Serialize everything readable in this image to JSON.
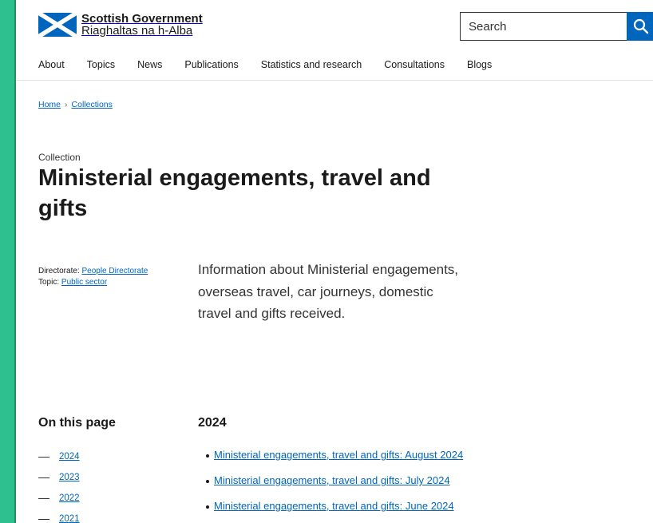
{
  "header": {
    "logo_en": "Scottish Government",
    "logo_gd": "Riaghaltas na h-Alba",
    "search_placeholder": "Search",
    "search_button_icon": "search-icon",
    "colors": {
      "accent": "#0065bd",
      "saltire_blue": "#0065bd",
      "saltire_white": "#ffffff",
      "backdrop": "#2fc08f"
    }
  },
  "nav": {
    "items": [
      "About",
      "Topics",
      "News",
      "Publications",
      "Statistics and research",
      "Consultations",
      "Blogs"
    ]
  },
  "breadcrumb": {
    "home": "Home",
    "separator": "›",
    "collections": "Collections"
  },
  "page": {
    "doc_type": "Collection",
    "title": "Ministerial engagements, travel and gifts",
    "directorate_label": "Directorate:",
    "directorate_value": "People Directorate",
    "topic_label": "Topic:",
    "topic_value": "Public sector",
    "summary": "Information about Ministerial engagements, overseas travel, car journeys, domestic travel and gifts received."
  },
  "on_this_page": {
    "heading": "On this page",
    "items": [
      "2024",
      "2023",
      "2022",
      "2021"
    ]
  },
  "section_2024": {
    "heading": "2024",
    "documents": [
      "Ministerial engagements, travel and gifts: August 2024",
      "Ministerial engagements, travel and gifts: July 2024",
      "Ministerial engagements, travel and gifts: June 2024"
    ]
  }
}
